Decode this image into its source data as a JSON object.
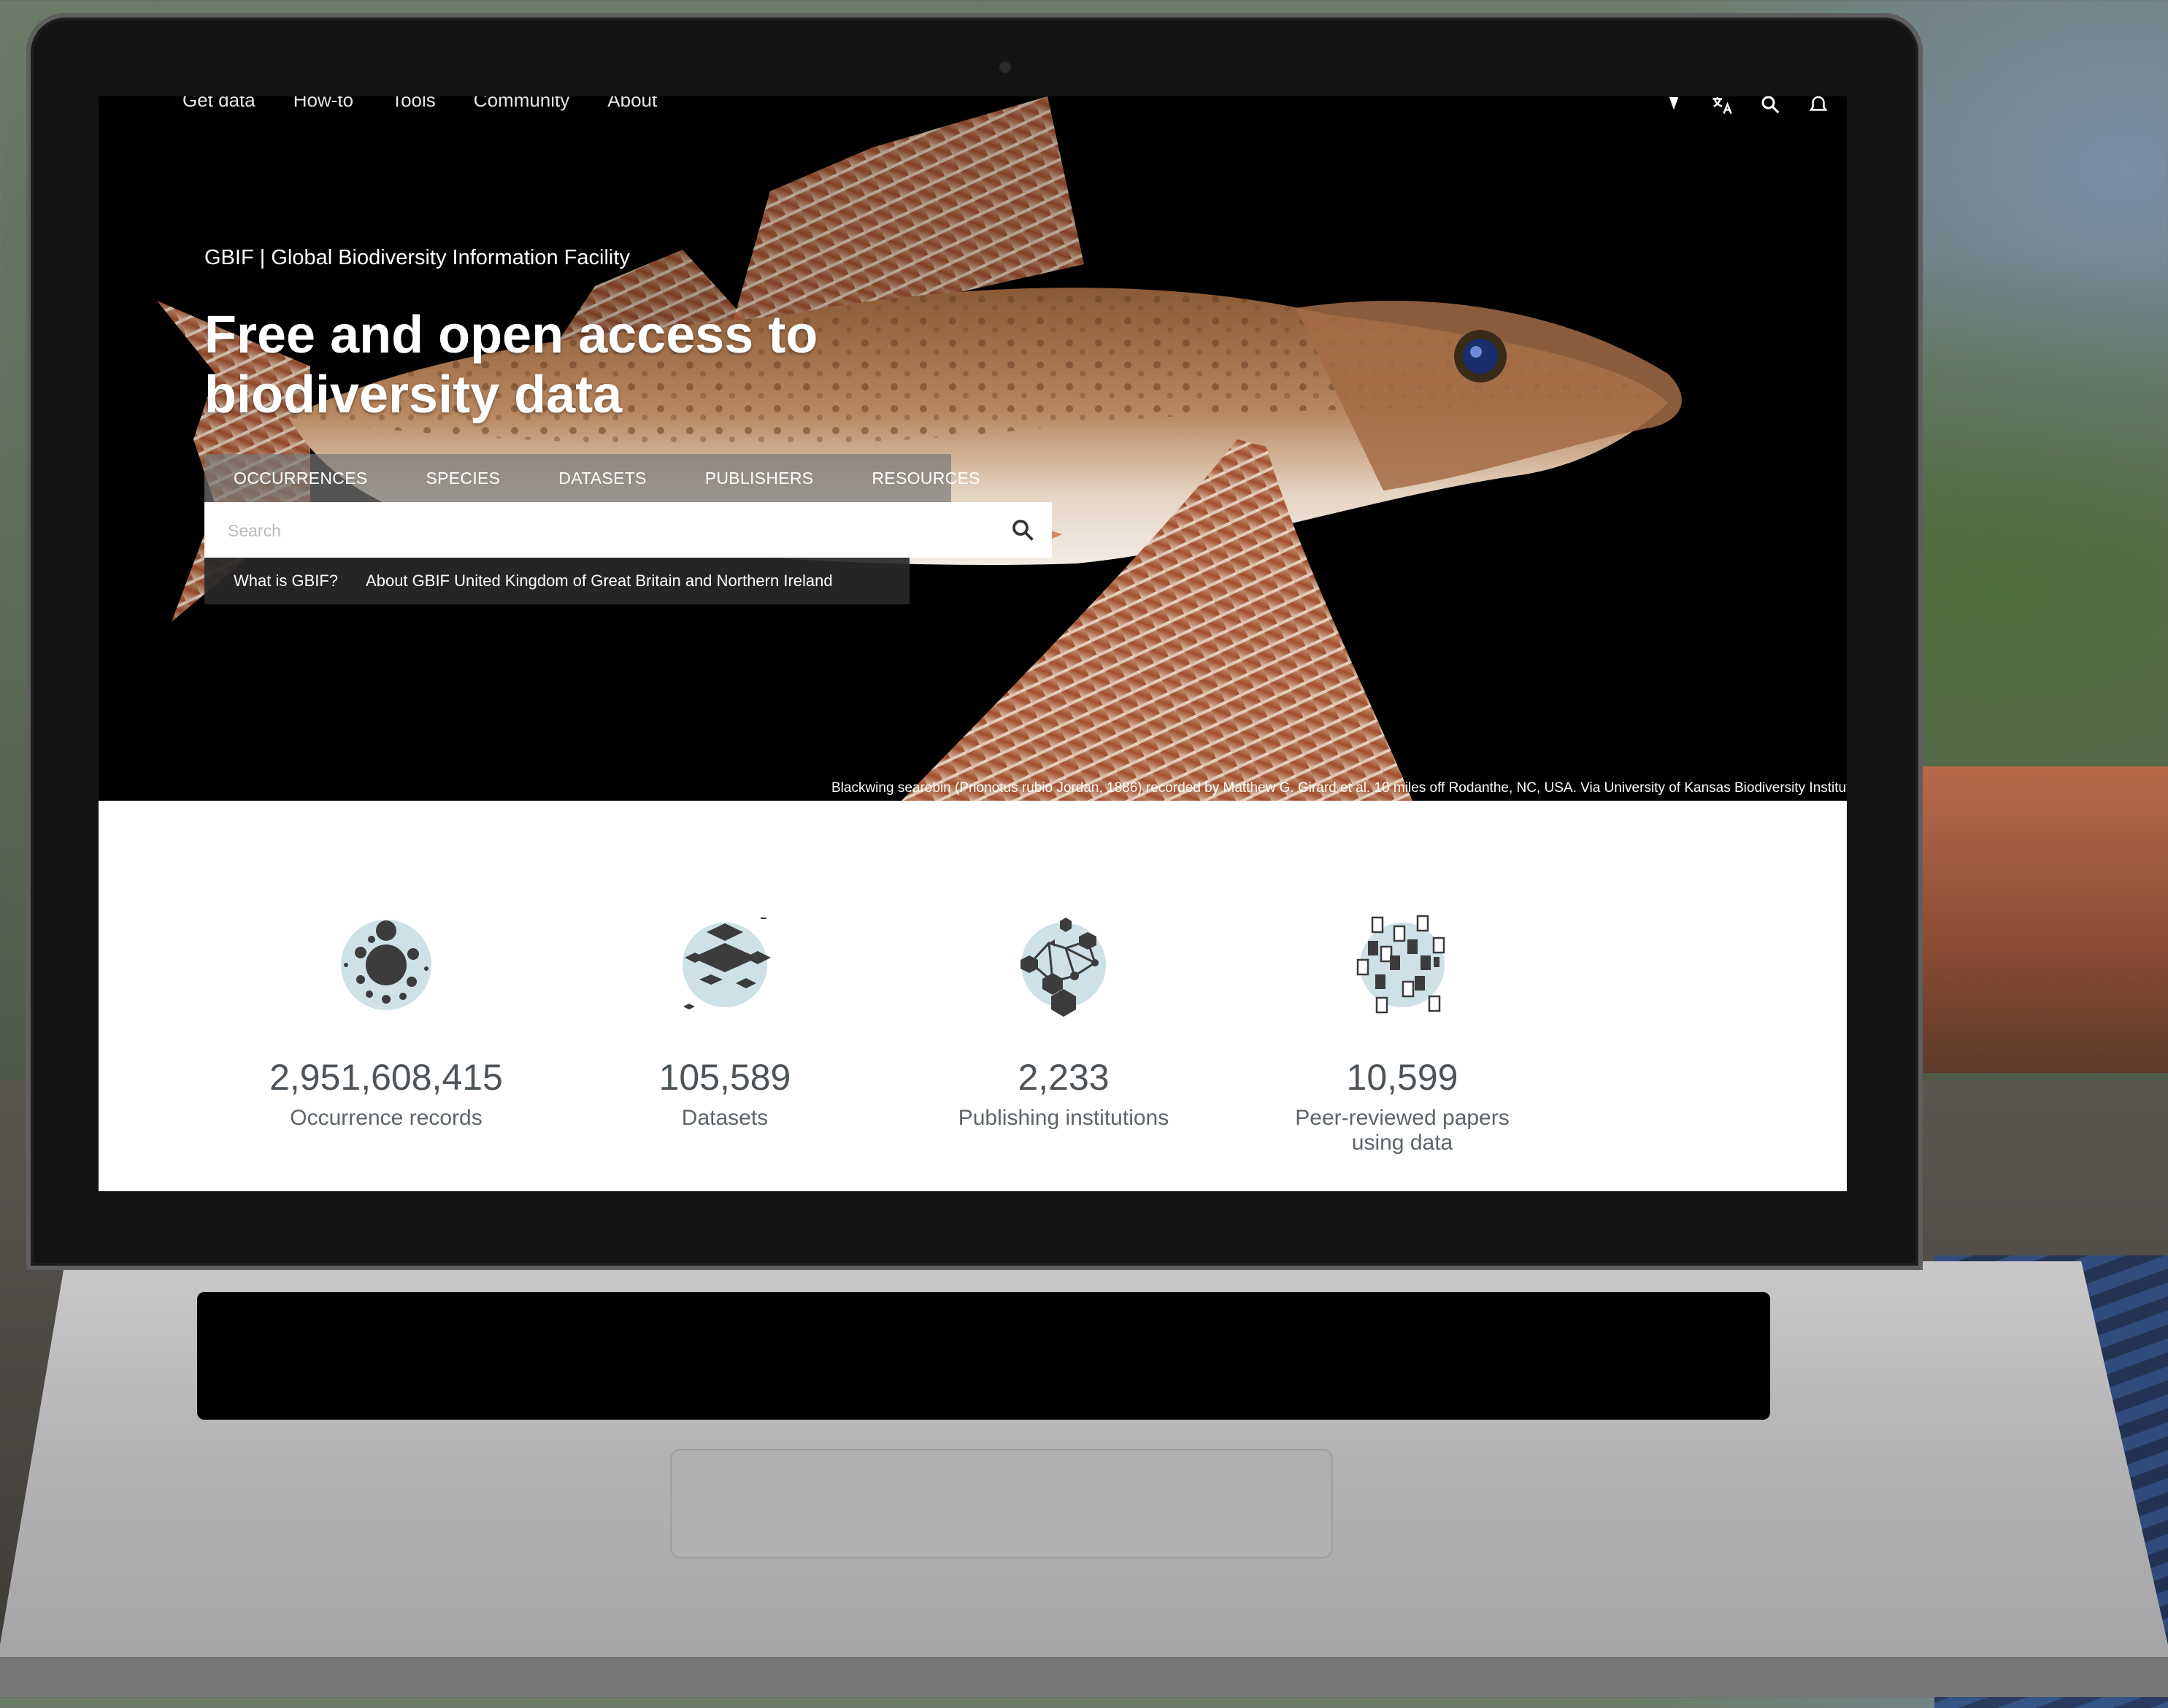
{
  "top_nav": {
    "items": [
      "Get data",
      "How-to",
      "Tools",
      "Community",
      "About"
    ],
    "icons": [
      "account-icon",
      "translate-icon",
      "search-icon",
      "notification-icon"
    ]
  },
  "hero": {
    "site_name": "GBIF | Global Biodiversity Information Facility",
    "headline": "Free and open access to biodiversity data",
    "tabs": [
      "OCCURRENCES",
      "SPECIES",
      "DATASETS",
      "PUBLISHERS",
      "RESOURCES"
    ],
    "search": {
      "placeholder": "Search",
      "value": ""
    },
    "quick_links": [
      "What is GBIF?",
      "About GBIF United Kingdom of Great Britain and Northern Ireland"
    ],
    "caption": "Blackwing searobin (Prionotus rubio Jordan, 1886) recorded by Matthew G. Girard et al. 10 miles off Rodanthe, NC, USA. Via University of Kansas Biodiversity Institute"
  },
  "stats": [
    {
      "number": "2,951,608,415",
      "label": "Occurrence records",
      "icon": "occurrence-icon"
    },
    {
      "number": "105,589",
      "label": "Datasets",
      "icon": "datasets-icon"
    },
    {
      "number": "2,233",
      "label": "Publishing institutions",
      "icon": "publishers-icon"
    },
    {
      "number": "10,599",
      "label": "Peer-reviewed papers using data",
      "icon": "papers-icon"
    }
  ],
  "colors": {
    "stat_text": "#4c5459",
    "icon_circle": "#cde1e6",
    "icon_shape": "#3c3c3c"
  }
}
